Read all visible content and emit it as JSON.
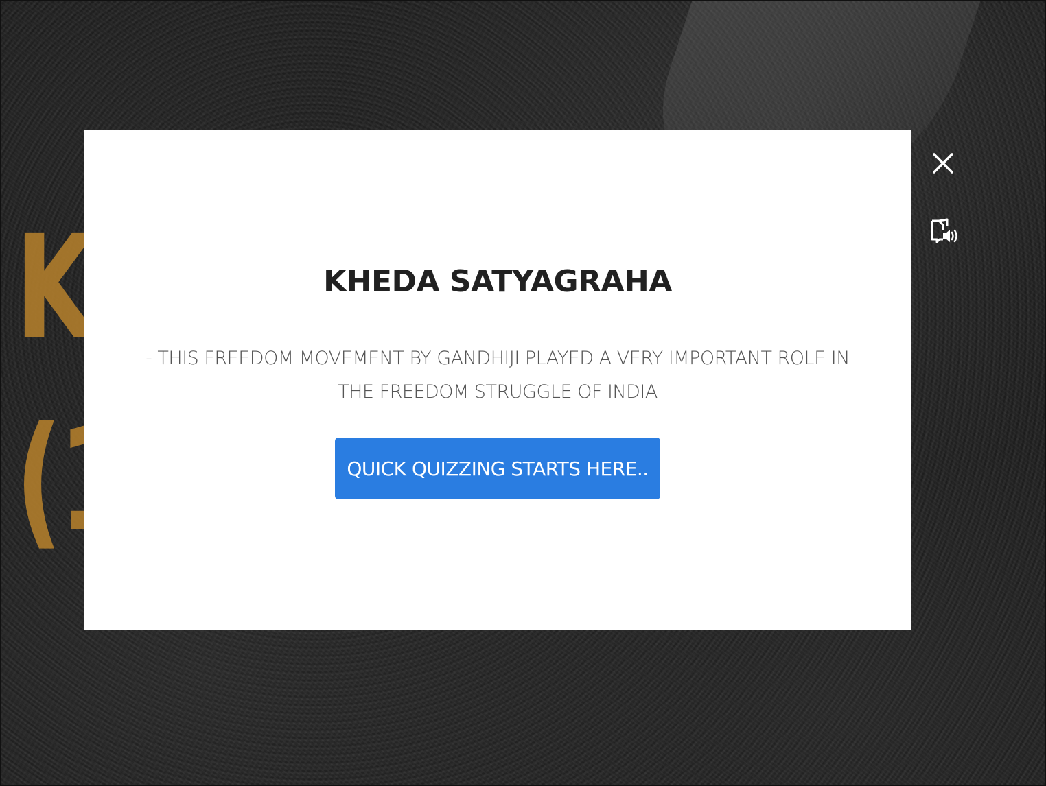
{
  "background": {
    "title_fragment": "K",
    "year_fragment": "(1",
    "accent_color": "#b07d2c"
  },
  "modal": {
    "title": "KHEDA SATYAGRAHA",
    "description": "- THIS FREEDOM MOVEMENT BY GANDHIJI PLAYED A VERY IMPORTANT ROLE IN THE FREEDOM STRUGGLE OF INDIA",
    "start_button_label": "QUICK QUIZZING STARTS HERE..",
    "button_color": "#2a7de1"
  },
  "controls": {
    "close_icon": "close-icon",
    "audio_icon": "book-audio-icon"
  }
}
